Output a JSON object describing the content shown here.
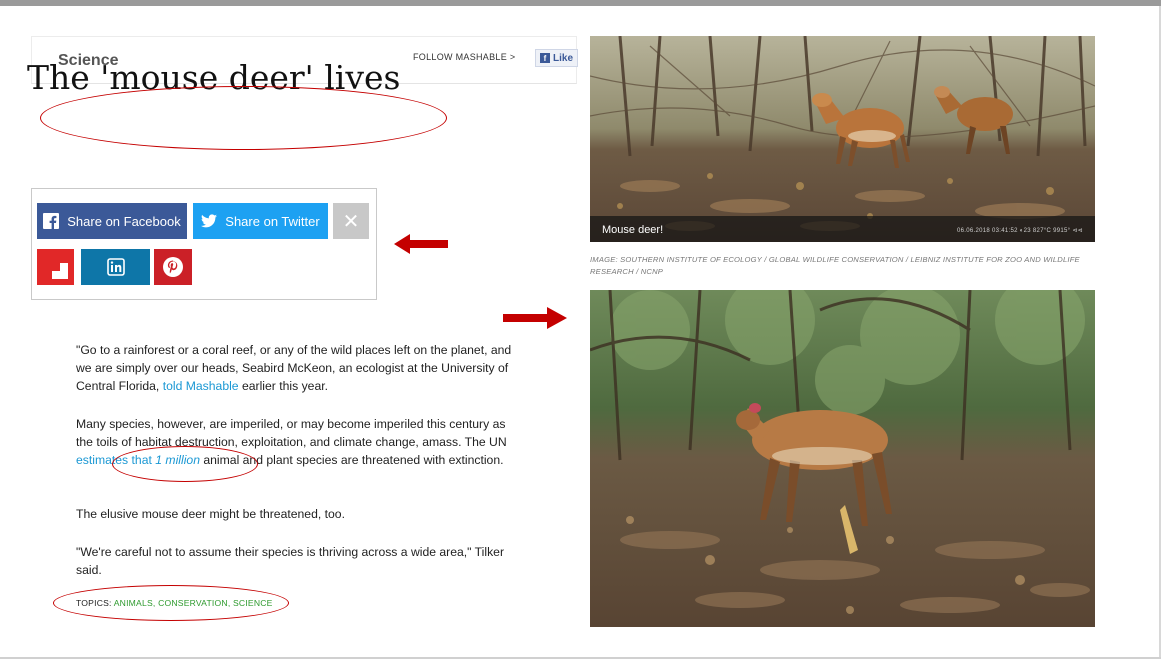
{
  "header": {
    "section": "Science",
    "follow_label": "FOLLOW MASHABLE >",
    "like_label": "Like"
  },
  "article": {
    "title": "The 'mouse deer' lives",
    "share": {
      "facebook_label": "Share on Facebook",
      "twitter_label": "Share on Twitter",
      "close_symbol": "✕"
    },
    "paragraphs": {
      "p1_before": "\"Go to a rainforest or a coral reef, or any of the wild places left on the planet, and we are simply over our heads, Seabird McKeon, an ecologist at the University of Central Florida, ",
      "p1_link": "told Mashable",
      "p1_after": " earlier this year.",
      "p2_before": "Many species, however, are imperiled, or may become imperiled this century as the toils of habitat destruction, exploitation, and climate change, amass. The UN ",
      "p2_link": "estimates that ",
      "p2_link_italic": "1 million",
      "p2_after": " animal and plant species are threatened with extinction.",
      "p3": "The elusive mouse deer might be threatened, too.",
      "p4": "\"We're careful not to assume their species is thriving across a wide area,\" Tilker said."
    },
    "topics": {
      "label": "TOPICS: ",
      "items": [
        "ANIMALS",
        "CONSERVATION",
        "SCIENCE"
      ],
      "separator": ", "
    }
  },
  "photos": {
    "caption": "Mouse deer!",
    "camera_stamp": "06.06.2018 03:41:52  ◐23  827°C 9915° ⊲⊲",
    "credit": "IMAGE: SOUTHERN INSTITUTE OF ECOLOGY / GLOBAL WILDLIFE CONSERVATION / LEIBNIZ INSTITUTE FOR ZOO AND WILDLIFE RESEARCH / NCNP"
  },
  "colors": {
    "annotation": "#c40000",
    "facebook": "#3b5998",
    "twitter": "#1da1f2",
    "linkedin": "#0e76a8",
    "pinterest": "#cb2027",
    "flipboard": "#e12828",
    "link": "#1b98d4",
    "topic": "#2e9a2e"
  },
  "icons": [
    "facebook-icon",
    "twitter-icon",
    "close-icon",
    "flipboard-icon",
    "linkedin-icon",
    "pinterest-icon",
    "arrow-left-icon",
    "arrow-right-icon"
  ]
}
